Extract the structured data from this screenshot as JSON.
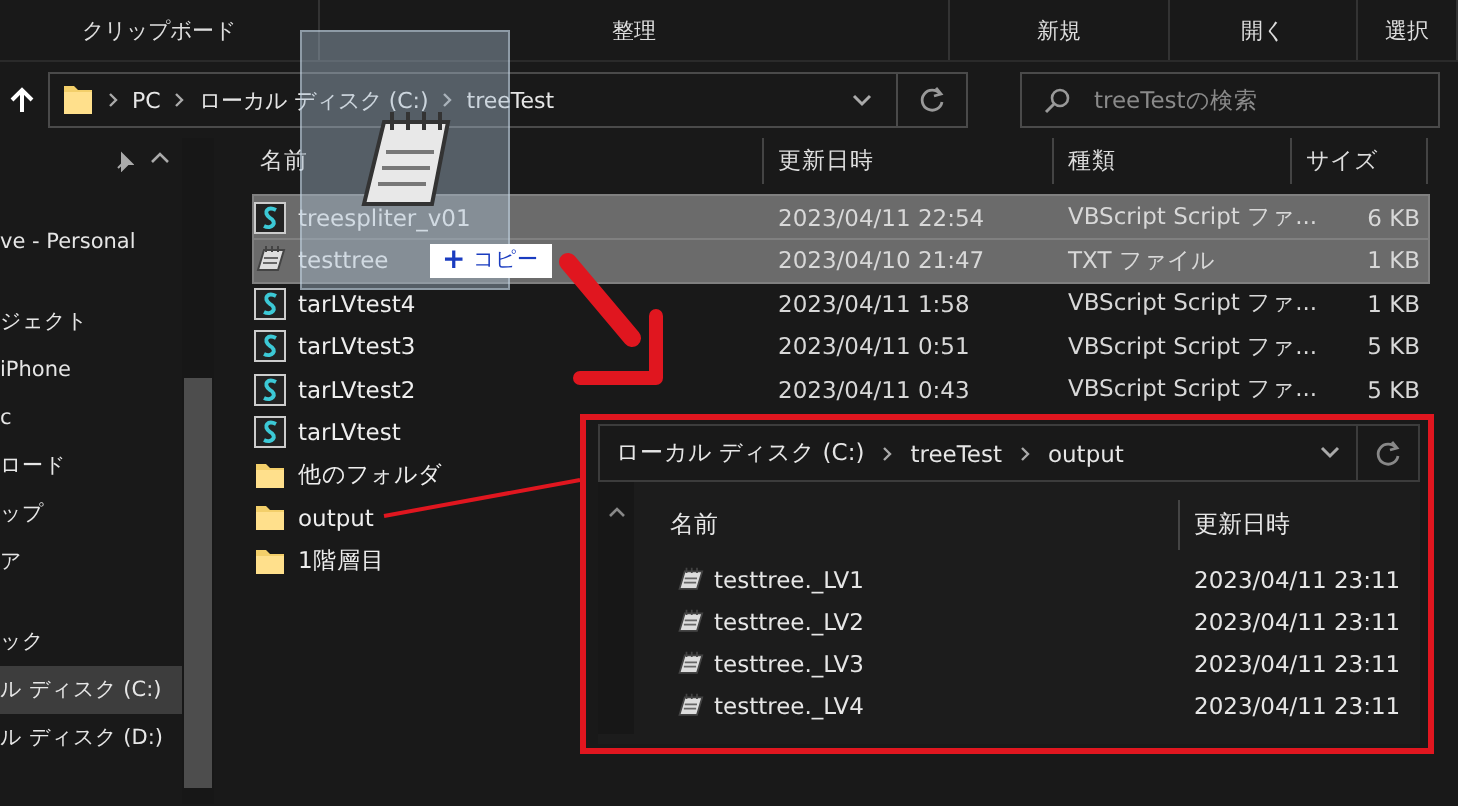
{
  "ribbon_groups": [
    "クリップボード",
    "整理",
    "新規",
    "開く",
    "選択"
  ],
  "address_bar": {
    "path": [
      "PC",
      "ローカル ディスク (C:)",
      "treeTest"
    ]
  },
  "search": {
    "placeholder": "treeTestの検索"
  },
  "sidebar": {
    "sections": [
      {
        "items": [
          {
            "label": "ve - Personal",
            "selected": false
          }
        ]
      },
      {
        "items": [
          {
            "label": "ジェクト",
            "selected": false
          },
          {
            "label": "iPhone",
            "selected": false
          },
          {
            "label": "c",
            "selected": false
          },
          {
            "label": "ロード",
            "selected": false
          },
          {
            "label": "ップ",
            "selected": false
          },
          {
            "label": "ア",
            "selected": false
          }
        ]
      },
      {
        "items": [
          {
            "label": "ック",
            "selected": false
          },
          {
            "label": "ル ディスク (C:)",
            "selected": true
          },
          {
            "label": "ル ディスク (D:)",
            "selected": false
          }
        ]
      }
    ]
  },
  "file_list": {
    "columns": [
      "名前",
      "更新日時",
      "種類",
      "サイズ"
    ],
    "rows": [
      {
        "kind": "script",
        "name": "treespliter_v01",
        "modified": "2023/04/11 22:54",
        "type": "VBScript Script ファ...",
        "size": "6 KB",
        "selected": true
      },
      {
        "kind": "text",
        "name": "testtree",
        "modified": "2023/04/10 21:47",
        "type": "TXT ファイル",
        "size": "1 KB",
        "selected": true
      },
      {
        "kind": "script",
        "name": "tarLVtest4",
        "modified": "2023/04/11 1:58",
        "type": "VBScript Script ファ...",
        "size": "1 KB",
        "selected": false
      },
      {
        "kind": "script",
        "name": "tarLVtest3",
        "modified": "2023/04/11 0:51",
        "type": "VBScript Script ファ...",
        "size": "5 KB",
        "selected": false
      },
      {
        "kind": "script",
        "name": "tarLVtest2",
        "modified": "2023/04/11 0:43",
        "type": "VBScript Script ファ...",
        "size": "5 KB",
        "selected": false
      },
      {
        "kind": "script",
        "name": "tarLVtest",
        "selected": false
      },
      {
        "kind": "folder",
        "name": "他のフォルダ",
        "selected": false
      },
      {
        "kind": "folder",
        "name": "output",
        "selected": false
      },
      {
        "kind": "folder",
        "name": "1階層目",
        "selected": false
      }
    ]
  },
  "drag": {
    "badge_symbol": "+",
    "badge_label": "コピー"
  },
  "inset": {
    "path": [
      "ローカル ディスク (C:)",
      "treeTest",
      "output"
    ],
    "columns": [
      "名前",
      "更新日時"
    ],
    "rows": [
      {
        "name": "testtree._LV1",
        "modified": "2023/04/11 23:11"
      },
      {
        "name": "testtree._LV2",
        "modified": "2023/04/11 23:11"
      },
      {
        "name": "testtree._LV3",
        "modified": "2023/04/11 23:11"
      },
      {
        "name": "testtree._LV4",
        "modified": "2023/04/11 23:11"
      }
    ]
  }
}
